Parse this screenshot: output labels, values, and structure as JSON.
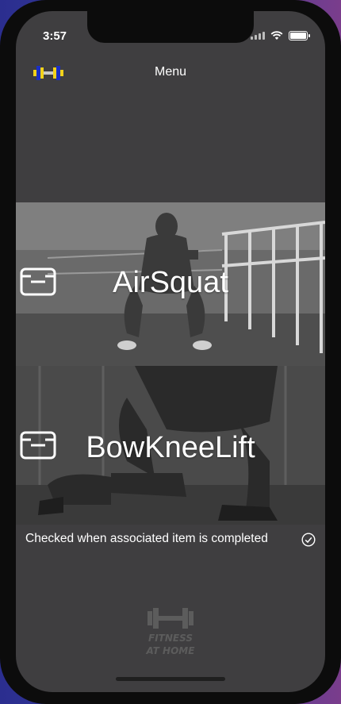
{
  "status_bar": {
    "time": "3:57"
  },
  "nav": {
    "title": "Menu"
  },
  "exercises": [
    {
      "title": "AirSquat"
    },
    {
      "title": "BowKneeLift"
    }
  ],
  "footer": {
    "note": "Checked when associated item is completed"
  },
  "brand": {
    "line1": "FITNESS",
    "line2": "AT HOME"
  },
  "colors": {
    "background": "#3f3e40",
    "logo_yellow": "#f2d21a",
    "logo_blue": "#1a2fc4"
  }
}
